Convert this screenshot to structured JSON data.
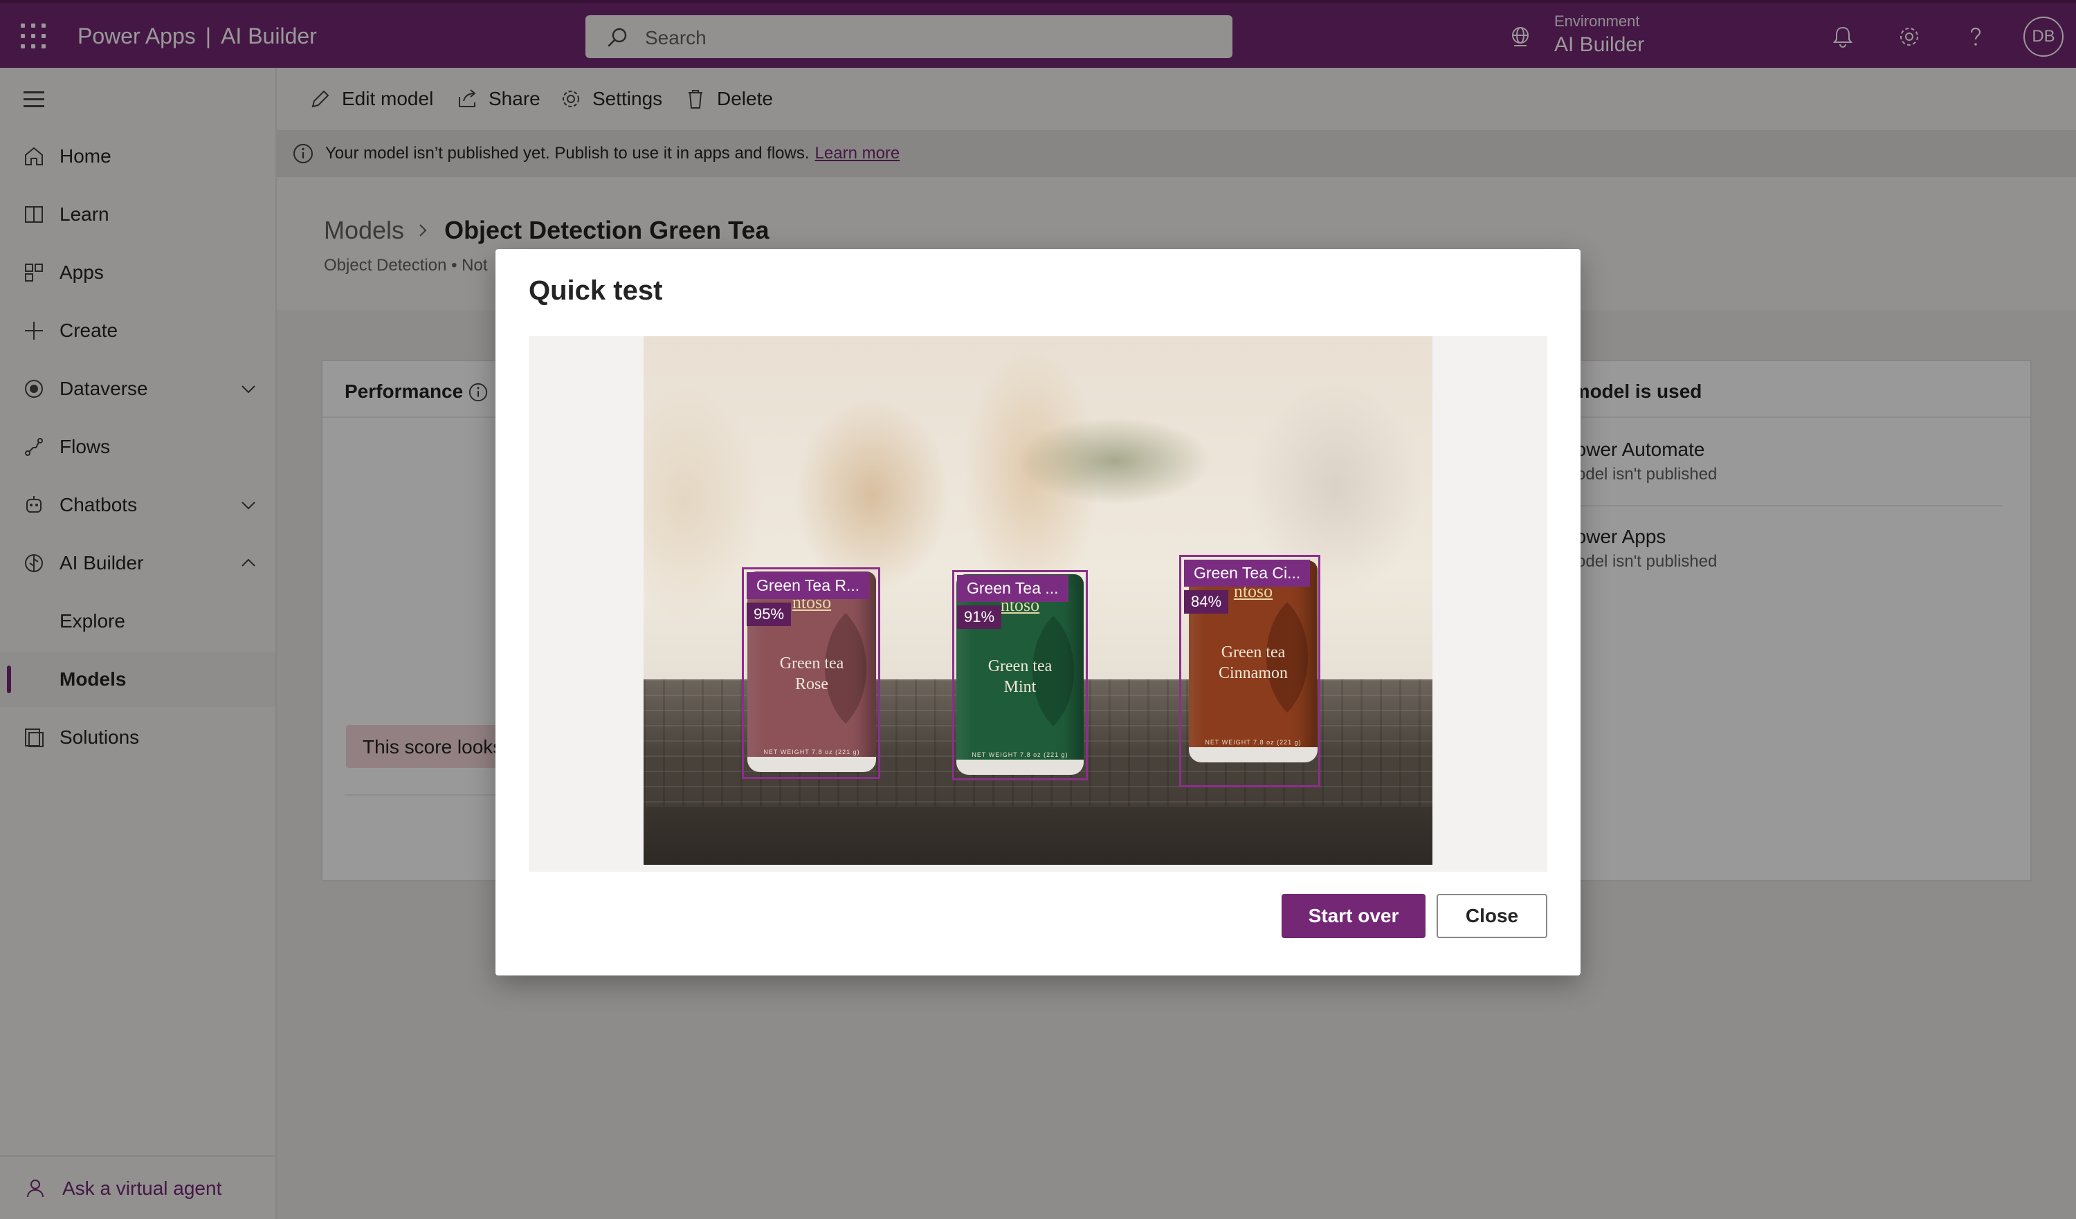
{
  "topbar": {
    "app_name": "Power Apps",
    "separator": "|",
    "product": "AI Builder",
    "search_placeholder": "Search",
    "environment_label": "Environment",
    "environment_value": "AI Builder",
    "avatar_initials": "DB",
    "background_color": "#742774"
  },
  "sidebar": {
    "items": [
      {
        "label": "Home",
        "icon": "home-icon"
      },
      {
        "label": "Learn",
        "icon": "book-icon"
      },
      {
        "label": "Apps",
        "icon": "apps-icon"
      },
      {
        "label": "Create",
        "icon": "plus-icon"
      },
      {
        "label": "Dataverse",
        "icon": "dataverse-icon"
      },
      {
        "label": "Flows",
        "icon": "flow-icon"
      },
      {
        "label": "Chatbots",
        "icon": "bot-icon"
      },
      {
        "label": "AI Builder",
        "icon": "ai-builder-icon"
      },
      {
        "label": "Explore"
      },
      {
        "label": "Models"
      },
      {
        "label": "Solutions",
        "icon": "solutions-icon"
      }
    ],
    "ask_agent": "Ask a virtual agent"
  },
  "commandbar": {
    "edit": "Edit model",
    "share": "Share",
    "settings": "Settings",
    "delete": "Delete"
  },
  "banner": {
    "text": "Your model isn’t published yet. Publish to use it in apps and flows.",
    "link": "Learn more"
  },
  "page": {
    "breadcrumb_root": "Models",
    "title": "Object Detection Green Tea",
    "subline": "Object Detection • Not"
  },
  "performance": {
    "title": "Performance",
    "score_text": "This score looks"
  },
  "usage": {
    "title": "r model is used",
    "items": [
      {
        "name": "Power Automate",
        "status": "Model isn't published"
      },
      {
        "name": "Power Apps",
        "status": "Model isn't published"
      }
    ]
  },
  "dialog": {
    "title": "Quick test",
    "detections": [
      {
        "label": "Green Tea R...",
        "confidence": "95%"
      },
      {
        "label": "Green Tea ...",
        "confidence": "91%"
      },
      {
        "label": "Green Tea Ci...",
        "confidence": "84%"
      }
    ],
    "cans": [
      {
        "brand": "ntoso",
        "flavor_line1": "Green tea",
        "flavor_line2": "Rose",
        "net": "NET WEIGHT 7.8 oz (221 g)",
        "color": "#8c5258"
      },
      {
        "brand": "ntoso",
        "flavor_line1": "Green tea",
        "flavor_line2": "Mint",
        "net": "NET WEIGHT 7.8 oz (221 g)",
        "color": "#1f5c3a"
      },
      {
        "brand": "ntoso",
        "flavor_line1": "Green tea",
        "flavor_line2": "Cinnamon",
        "net": "NET WEIGHT 7.8 oz (221 g)",
        "color": "#8a3c1c"
      }
    ],
    "start_over": "Start over",
    "close": "Close"
  }
}
